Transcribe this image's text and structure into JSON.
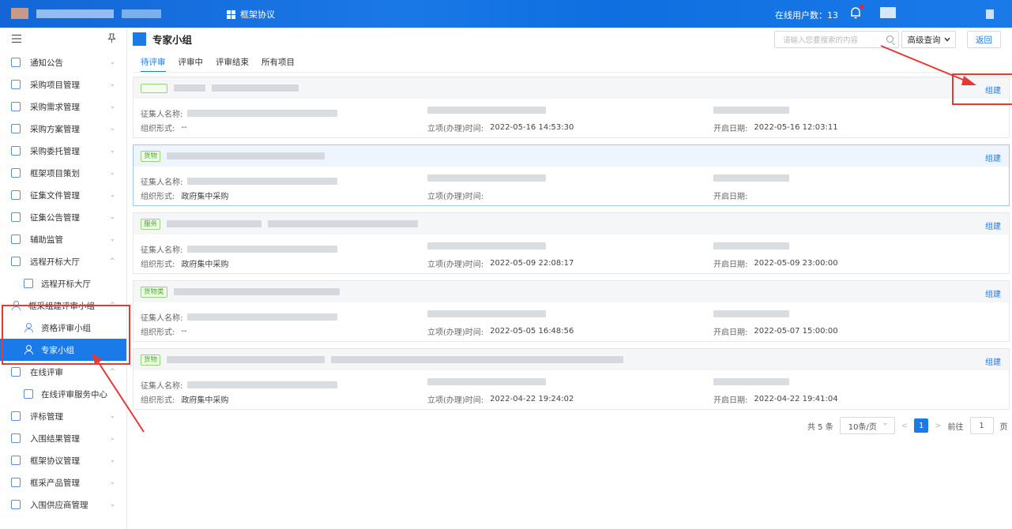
{
  "topbar": {
    "nav_label": "框架协议",
    "online_label": "在线用户数：13"
  },
  "sidebar": {
    "items": [
      {
        "label": "通知公告",
        "icon": "folder-icon",
        "chevron": "⌄"
      },
      {
        "label": "采购项目管理",
        "icon": "folder-icon",
        "chevron": "⌄"
      },
      {
        "label": "采购需求管理",
        "icon": "document-icon",
        "chevron": "⌄"
      },
      {
        "label": "采购方案管理",
        "icon": "document-icon",
        "chevron": "⌄"
      },
      {
        "label": "采购委托管理",
        "icon": "document-icon",
        "chevron": "⌄"
      },
      {
        "label": "框架项目策划",
        "icon": "folder-icon",
        "chevron": "⌄"
      },
      {
        "label": "征集文件管理",
        "icon": "document-icon",
        "chevron": "⌄"
      },
      {
        "label": "征集公告管理",
        "icon": "document-icon",
        "chevron": "⌄"
      },
      {
        "label": "辅助监管",
        "icon": "monitor-icon",
        "chevron": "⌄"
      },
      {
        "label": "远程开标大厅",
        "icon": "document-icon",
        "chevron": "^"
      },
      {
        "label": "远程开标大厅",
        "icon": "document-icon",
        "sub": true
      },
      {
        "label": "框采组建评审小组",
        "icon": "person-icon",
        "chevron": "^"
      },
      {
        "label": "资格评审小组",
        "icon": "person-icon",
        "sub": true
      },
      {
        "label": "专家小组",
        "icon": "person-icon",
        "sub": true,
        "active": true
      },
      {
        "label": "在线评审",
        "icon": "monitor-icon",
        "chevron": "^"
      },
      {
        "label": "在线评审服务中心",
        "icon": "monitor-icon",
        "sub": true
      },
      {
        "label": "评标管理",
        "icon": "document-icon",
        "chevron": "⌄"
      },
      {
        "label": "入围结果管理",
        "icon": "document-icon",
        "chevron": "⌄"
      },
      {
        "label": "框架协议管理",
        "icon": "document-icon",
        "chevron": "⌄"
      },
      {
        "label": "框采产品管理",
        "icon": "document-icon",
        "chevron": "⌄"
      },
      {
        "label": "入围供应商管理",
        "icon": "document-icon",
        "chevron": "⌄"
      }
    ]
  },
  "main": {
    "title": "专家小组",
    "search_placeholder": "请输入您要搜索的内容",
    "advanced_label": "高级查询",
    "back_label": "返回",
    "tabs": [
      "待评审",
      "评审中",
      "评审结束",
      "所有项目"
    ],
    "labels": {
      "collector": "征集人名称:",
      "org_form": "组织形式:",
      "setup_time": "立项(办理)时间:",
      "open_date": "开启日期:",
      "build": "组建"
    },
    "cards": [
      {
        "tag": "",
        "org_form": "--",
        "setup_time": "2022-05-16 14:53:30",
        "open_date": "2022-05-16 12:03:11"
      },
      {
        "tag": "货物",
        "org_form": "政府集中采购",
        "setup_time": "",
        "open_date": ""
      },
      {
        "tag": "服务",
        "org_form": "政府集中采购",
        "setup_time": "2022-05-09 22:08:17",
        "open_date": "2022-05-09 23:00:00"
      },
      {
        "tag": "货物类",
        "org_form": "--",
        "setup_time": "2022-05-05 16:48:56",
        "open_date": "2022-05-07 15:00:00"
      },
      {
        "tag": "货物",
        "org_form": "政府集中采购",
        "setup_time": "2022-04-22 19:24:02",
        "open_date": "2022-04-22 19:41:04"
      }
    ],
    "pager": {
      "total": "共 5 条",
      "page_size": "10条/页",
      "prev": "<",
      "current": "1",
      "next": ">",
      "goto_label": "前往",
      "goto_value": "1",
      "page_unit": "页"
    }
  },
  "colors": {
    "accent": "#1a7ae8",
    "annotation": "#e53935",
    "tag_green": "#4bab2a"
  }
}
